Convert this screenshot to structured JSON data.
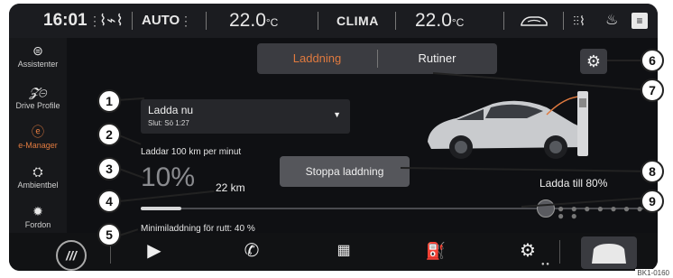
{
  "topbar": {
    "time": "16:01",
    "fan_mode": "AUTO",
    "temp_left": "22.0",
    "temp_left_unit": "°C",
    "clima_label": "CLIMA",
    "temp_right": "22.0",
    "temp_right_unit": "°C"
  },
  "sidebar": {
    "items": [
      {
        "label": "Assistenter",
        "icon": "steering-wheel-icon"
      },
      {
        "label": "Drive Profile",
        "icon": "drive-profile-icon"
      },
      {
        "label": "e-Manager",
        "icon": "e-manager-icon"
      },
      {
        "label": "Ambientbel",
        "icon": "ambient-light-icon"
      },
      {
        "label": "Fordon",
        "icon": "gear-icon"
      }
    ]
  },
  "tabs": {
    "charging": "Laddning",
    "routines": "Rutiner"
  },
  "charge": {
    "mode": "Ladda nu",
    "end": "Slut: Sö 1:27",
    "rate": "Laddar 100 km per minut",
    "percent": "10%",
    "range": "22 km",
    "stop_button": "Stoppa laddning",
    "target": "Ladda till 80%",
    "min_for_route": "Minimiladdning för rutt: 40 %",
    "level_fraction": 0.1,
    "target_fraction": 0.8
  },
  "callouts": [
    "1",
    "2",
    "3",
    "4",
    "5",
    "6",
    "7",
    "8",
    "9"
  ],
  "reference_code": "BK1-0160",
  "colors": {
    "accent_orange": "#e07a3f",
    "background": "#0f1013",
    "panel": "#3b3c41"
  }
}
